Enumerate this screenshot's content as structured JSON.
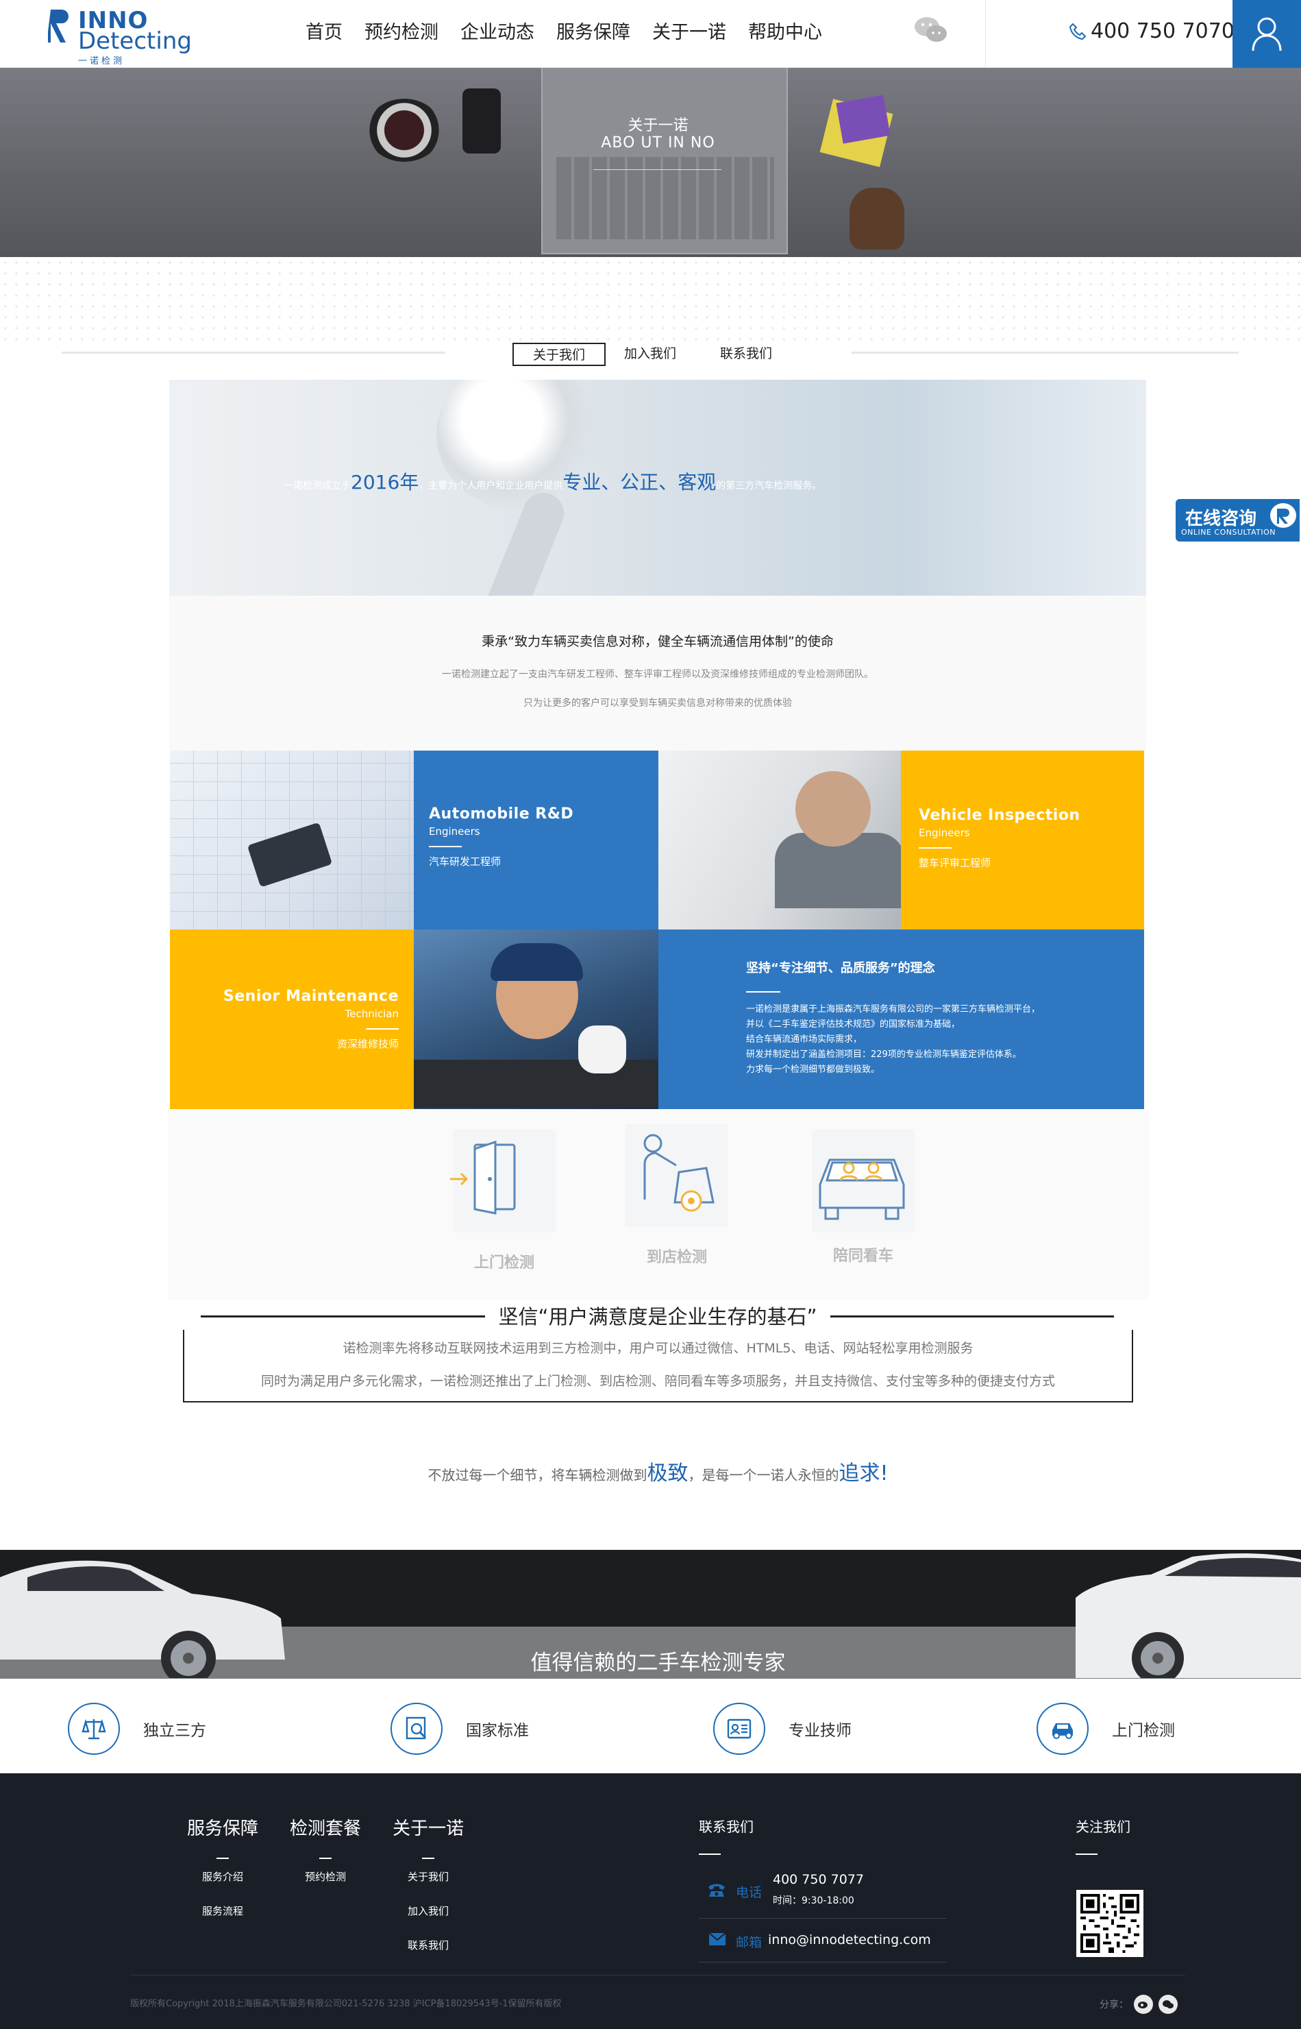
{
  "colors": {
    "brand_blue": "#1c6db8",
    "accent_yellow": "#ffbb00",
    "footer_bg": "#1a1e27"
  },
  "header": {
    "logo": {
      "line1": "INNO",
      "line2": "Detecting",
      "line3": "一诺检测"
    },
    "nav": [
      "首页",
      "预约检测",
      "企业动态",
      "服务保障",
      "关于一诺",
      "帮助中心"
    ],
    "phone": "400 750 7070",
    "icons": {
      "wechat": "wechat-icon",
      "phone": "phone-icon",
      "user": "user-icon"
    }
  },
  "banner": {
    "title": "关于一诺",
    "subtitle": "ABO UT IN NO"
  },
  "subnav": {
    "tabs": [
      "关于我们",
      "加入我们",
      "联系我们"
    ],
    "active": "关于我们"
  },
  "hero": {
    "pre": "一诺检测成立于",
    "year": "2016年",
    "mid": "，主要为个人用户和企业用户提供",
    "values": "专业、公正、客观",
    "post": "的第三方汽车检测服务。"
  },
  "mission": {
    "title": "秉承“致力车辆买卖信息对称，健全车辆流通信用体制”的使命",
    "line1": "一诺检测建立起了一支由汽车研发工程师、整车评审工程师以及资深维修技师组成的专业检测师团队。",
    "line2": "只为让更多的客户可以享受到车辆买卖信息对称带来的优质体验"
  },
  "team": {
    "rnd": {
      "en": "Automobile R&D",
      "en2": "Engineers",
      "cn": "汽车研发工程师"
    },
    "vehicle": {
      "en": "Vehicle Inspection",
      "en2": "Engineers",
      "cn": "整车评审工程师"
    },
    "senior": {
      "en": "Senior Maintenance",
      "en2": "Technician",
      "cn": "资深维修技师"
    },
    "philosophy": {
      "title": "坚持“专注细节、品质服务”的理念",
      "lines": [
        "一诺检测是隶属于上海振森汽车服务有限公司的一家第三方车辆检测平台，",
        "并以《二手车鉴定评估技术规范》的国家标准为基础，",
        "结合车辆流通市场实际需求，",
        "研发并制定出了涵盖检测项目：229项的专业检测车辆鉴定评估体系。",
        "力求每一个检测细节都做到极致。"
      ]
    }
  },
  "services": [
    {
      "label": "上门检测",
      "icon": "door-arrow-icon"
    },
    {
      "label": "到店检测",
      "icon": "mechanic-car-icon"
    },
    {
      "label": "陪同看车",
      "icon": "car-people-icon"
    }
  ],
  "belief": {
    "title": "坚信“用户满意度是企业生存的基石”",
    "line1": "诺检测率先将移动互联网技术运用到三方检测中，用户可以通过微信、HTML5、电话、网站轻松享用检测服务",
    "line2": "同时为满足用户多元化需求，一诺检测还推出了上门检测、到店检测、陪同看车等多项服务，并且支持微信、支付宝等多种的便捷支付方式"
  },
  "slogan": {
    "pre": "不放过每一个细节，将车辆检测做到",
    "hl1": "极致",
    "mid": "，是每一个一诺人永恒的",
    "hl2": "追求!"
  },
  "car_band": {
    "title": "值得信赖的二手车检测专家"
  },
  "features": [
    {
      "label": "独立三方",
      "icon": "scale-icon"
    },
    {
      "label": "国家标准",
      "icon": "magnifier-doc-icon"
    },
    {
      "label": "专业技师",
      "icon": "certificate-icon"
    },
    {
      "label": "上门检测",
      "icon": "car-icon"
    }
  ],
  "footer": {
    "cols": [
      {
        "title": "服务保障",
        "items": [
          "服务介绍",
          "服务流程"
        ]
      },
      {
        "title": "检测套餐",
        "items": [
          "预约检测"
        ]
      },
      {
        "title": "关于一诺",
        "items": [
          "关于我们",
          "加入我们",
          "联系我们"
        ]
      }
    ],
    "contact": {
      "title": "联系我们",
      "phone_label": "电话",
      "phone": "400 750 7077",
      "hours": "时间：9:30-18:00",
      "mail_label": "邮箱",
      "email": "inno@innodetecting.com"
    },
    "follow": {
      "title": "关注我们"
    },
    "copyright": "版权所有Copyright 2018上海振森汽车服务有限公司021-5276 3238 沪ICP备18029543号-1保留所有版权",
    "share": "分享："
  },
  "consult": {
    "title": "在线咨询",
    "subtitle": "ONLINE CONSULTATION"
  }
}
